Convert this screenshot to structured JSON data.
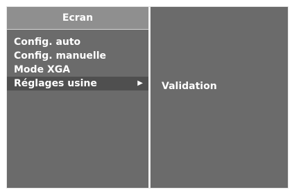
{
  "menu": {
    "title": "Ecran",
    "items": [
      {
        "label": "Config. auto"
      },
      {
        "label": "Config. manuelle"
      },
      {
        "label": "Mode XGA"
      },
      {
        "label": "Réglages usine",
        "selected": true,
        "arrow": "▶"
      }
    ]
  },
  "submenu": {
    "item": "Validation"
  },
  "colors": {
    "panel": "#6b6b6b",
    "title_bar": "#8f8f8f",
    "selected_row": "#4f4f4f",
    "text": "#ffffff",
    "border": "#e6e6e6"
  },
  "icons": {
    "arrow": "triangle-right-icon"
  }
}
